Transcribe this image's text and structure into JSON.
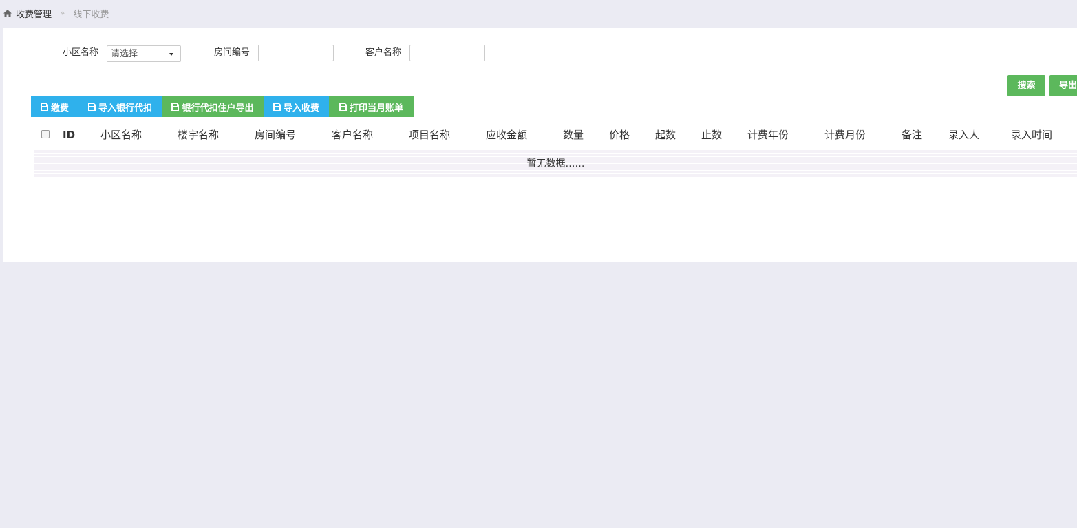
{
  "breadcrumb": {
    "level1": "收费管理",
    "separator": "»",
    "level2": "线下收费"
  },
  "filters": {
    "community_label": "小区名称",
    "community_select_value": "请选择",
    "room_label": "房间编号",
    "room_value": "",
    "customer_label": "客户名称",
    "customer_value": ""
  },
  "actions": {
    "search_label": "搜索",
    "export_label": "导出"
  },
  "toolbar": {
    "pay_label": "缴费",
    "import_bank_label": "导入银行代扣",
    "bank_export_label": "银行代扣住户导出",
    "import_payment_label": "导入收费",
    "print_bill_label": "打印当月账单"
  },
  "table": {
    "columns": [
      "ID",
      "小区名称",
      "楼宇名称",
      "房间编号",
      "客户名称",
      "项目名称",
      "应收金额",
      "数量",
      "价格",
      "起数",
      "止数",
      "计费年份",
      "计费月份",
      "备注",
      "录入人",
      "录入时间"
    ],
    "empty_text": "暂无数据……"
  },
  "colors": {
    "background": "#ebebf3",
    "green": "#5cb85c",
    "blue": "#2fb1ec"
  }
}
